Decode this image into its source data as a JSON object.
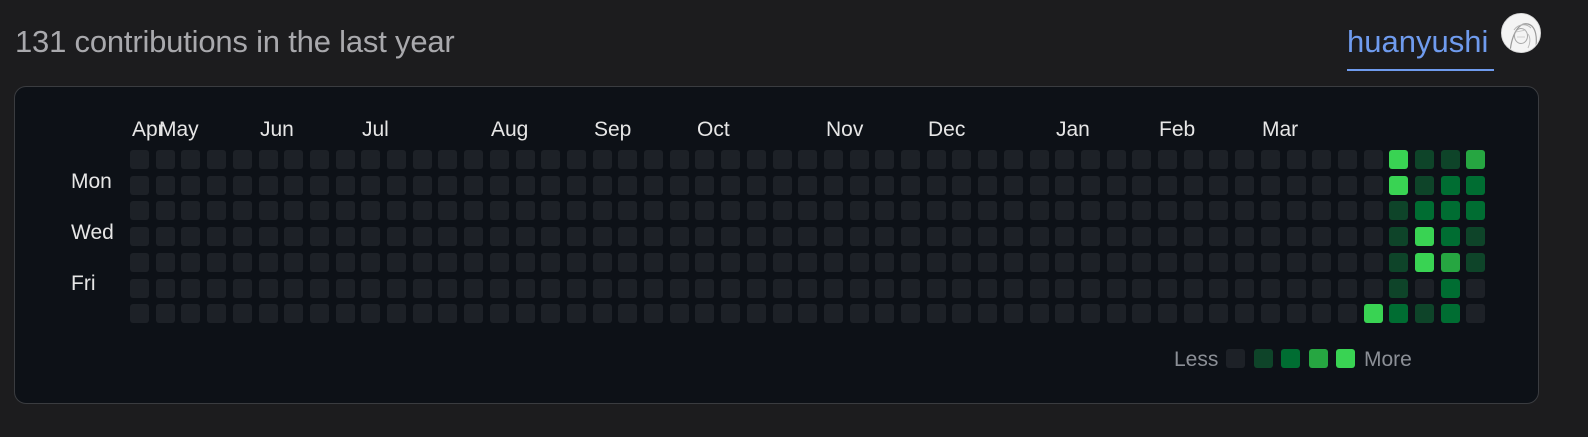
{
  "header": {
    "title": "131 contributions in the last year",
    "username": "huanyushi"
  },
  "calendar": {
    "months": [
      "Apr",
      "May",
      "Jun",
      "Jul",
      "Aug",
      "Sep",
      "Oct",
      "Nov",
      "Dec",
      "Jan",
      "Feb",
      "Mar"
    ],
    "days": [
      "Mon",
      "Wed",
      "Fri"
    ],
    "weeks": 53,
    "last_week_days": 7,
    "level_colors": [
      "#1d2127",
      "#0e4429",
      "#006d32",
      "#26a641",
      "#39d353"
    ],
    "active_weeks": [
      [
        0,
        0,
        0,
        0,
        0,
        0,
        4
      ],
      [
        4,
        4,
        1,
        1,
        1,
        1,
        2
      ],
      [
        1,
        1,
        2,
        4,
        4,
        0,
        1
      ],
      [
        1,
        2,
        2,
        2,
        3,
        2,
        2
      ],
      [
        3,
        2,
        2,
        1,
        1,
        0,
        0
      ]
    ],
    "legend": {
      "less": "Less",
      "more": "More"
    }
  }
}
